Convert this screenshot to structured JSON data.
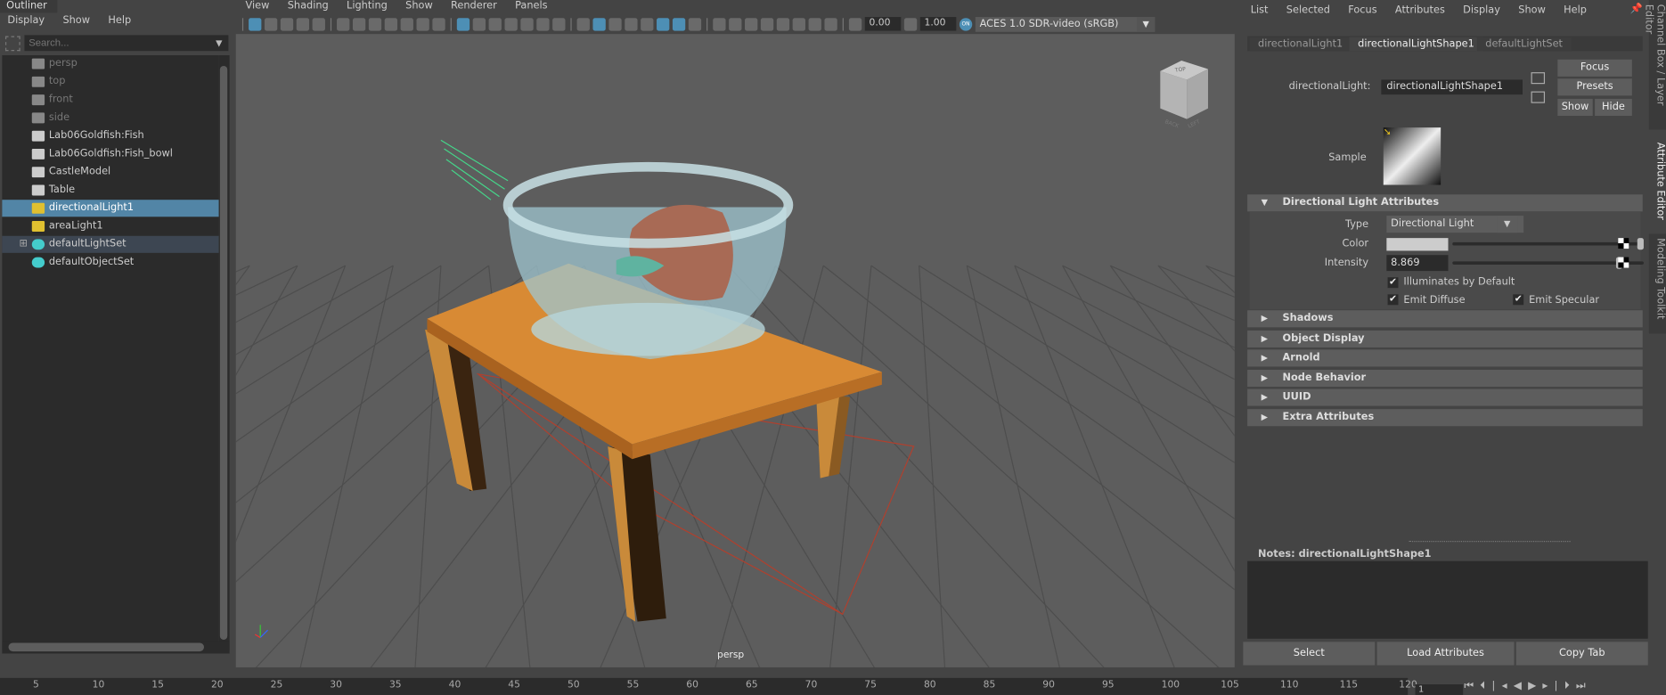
{
  "outliner": {
    "title": "Outliner",
    "menu": [
      "Display",
      "Show",
      "Help"
    ],
    "search_placeholder": "Search...",
    "items": [
      {
        "label": "persp",
        "icon": "camera-icon"
      },
      {
        "label": "top",
        "icon": "camera-icon"
      },
      {
        "label": "front",
        "icon": "camera-icon"
      },
      {
        "label": "side",
        "icon": "camera-icon"
      },
      {
        "label": "Lab06Goldfish:Fish",
        "icon": "transform-icon"
      },
      {
        "label": "Lab06Goldfish:Fish_bowl",
        "icon": "transform-icon"
      },
      {
        "label": "CastleModel",
        "icon": "transform-icon"
      },
      {
        "label": "Table",
        "icon": "transform-icon"
      },
      {
        "label": "directionalLight1",
        "icon": "directional-light-icon"
      },
      {
        "label": "areaLight1",
        "icon": "area-light-icon"
      },
      {
        "label": "defaultLightSet",
        "icon": "set-icon"
      },
      {
        "label": "defaultObjectSet",
        "icon": "set-icon"
      }
    ]
  },
  "viewport": {
    "menu": [
      "View",
      "Shading",
      "Lighting",
      "Show",
      "Renderer",
      "Panels"
    ],
    "toolbar_icons_a": [
      "select-camera-icon",
      "camera-attributes-icon",
      "bookmark-icon",
      "image-plane-icon",
      "2d-pan-icon"
    ],
    "toolbar_icons_b": [
      "camera-icon",
      "lock-camera-icon",
      "camera-attr-icon",
      "bookmark-icon",
      "grease-pencil-icon",
      "pan-zoom-icon",
      "paint-icon"
    ],
    "toolbar_icons_c": [
      "grid-icon",
      "film-gate-icon",
      "resolution-gate-icon",
      "gate-mask-icon",
      "field-chart-icon",
      "safe-action-icon",
      "safe-title-icon"
    ],
    "toolbar_icons_d": [
      "wireframe-icon",
      "smooth-shade-icon",
      "shaded-wireframe-icon",
      "wireframe-on-shaded-icon",
      "xray-icon",
      "textured-icon",
      "lights-icon",
      "shadows-icon"
    ],
    "toolbar_icons_e": [
      "ambient-occlusion-icon",
      "motion-blur-icon",
      "anti-alias-icon",
      "depth-of-field-icon",
      "isolate-select-icon",
      "xray-joints-icon",
      "xray-active-icon",
      "backface-icon"
    ],
    "exposure": "0.00",
    "gamma": "1.00",
    "color_mgmt_badge": "ON",
    "color_space": "ACES 1.0 SDR-video (sRGB)",
    "camera_label": "persp",
    "viewcube": [
      "TOP",
      "BACK",
      "LEFT"
    ]
  },
  "attribute_editor": {
    "menu": [
      "List",
      "Selected",
      "Focus",
      "Attributes",
      "Display",
      "Show",
      "Help"
    ],
    "tabs": [
      "directionalLight1",
      "directionalLightShape1",
      "defaultLightSet"
    ],
    "active_tab": 1,
    "node_label": "directionalLight:",
    "node_value": "directionalLightShape1",
    "buttons": {
      "focus": "Focus",
      "presets": "Presets",
      "show": "Show",
      "hide": "Hide"
    },
    "sample_label": "Sample",
    "section_open": "Directional Light Attributes",
    "type_label": "Type",
    "type_value": "Directional Light",
    "color_label": "Color",
    "color_value": "#cccccc",
    "color_slider": 1.0,
    "intensity_label": "Intensity",
    "intensity_value": "8.869",
    "intensity_slider": 0.887,
    "checks": [
      {
        "label": "Illuminates by Default",
        "checked": true
      },
      {
        "label": "Emit Diffuse",
        "checked": true
      },
      {
        "label": "Emit Specular",
        "checked": true
      }
    ],
    "sections": [
      "Shadows",
      "Object Display",
      "Arnold",
      "Node Behavior",
      "UUID",
      "Extra Attributes"
    ],
    "notes_label": "Notes:  directionalLightShape1",
    "bottom_buttons": [
      "Select",
      "Load Attributes",
      "Copy Tab"
    ]
  },
  "side_tabs": [
    "Channel Box / Layer Editor",
    "Attribute Editor",
    "Modeling Toolkit"
  ],
  "timeline": {
    "ticks": [
      "5",
      "10",
      "15",
      "20",
      "25",
      "30",
      "35",
      "40",
      "45",
      "50",
      "55",
      "60",
      "65",
      "70",
      "75",
      "80",
      "85",
      "90",
      "95",
      "100",
      "105",
      "110",
      "115",
      "120"
    ],
    "current_frame": "1"
  },
  "colors": {
    "selection": "#5285a6",
    "accent": "#4d8fb5",
    "grid_light": "#48e08a",
    "area_light": "#c0392b"
  }
}
